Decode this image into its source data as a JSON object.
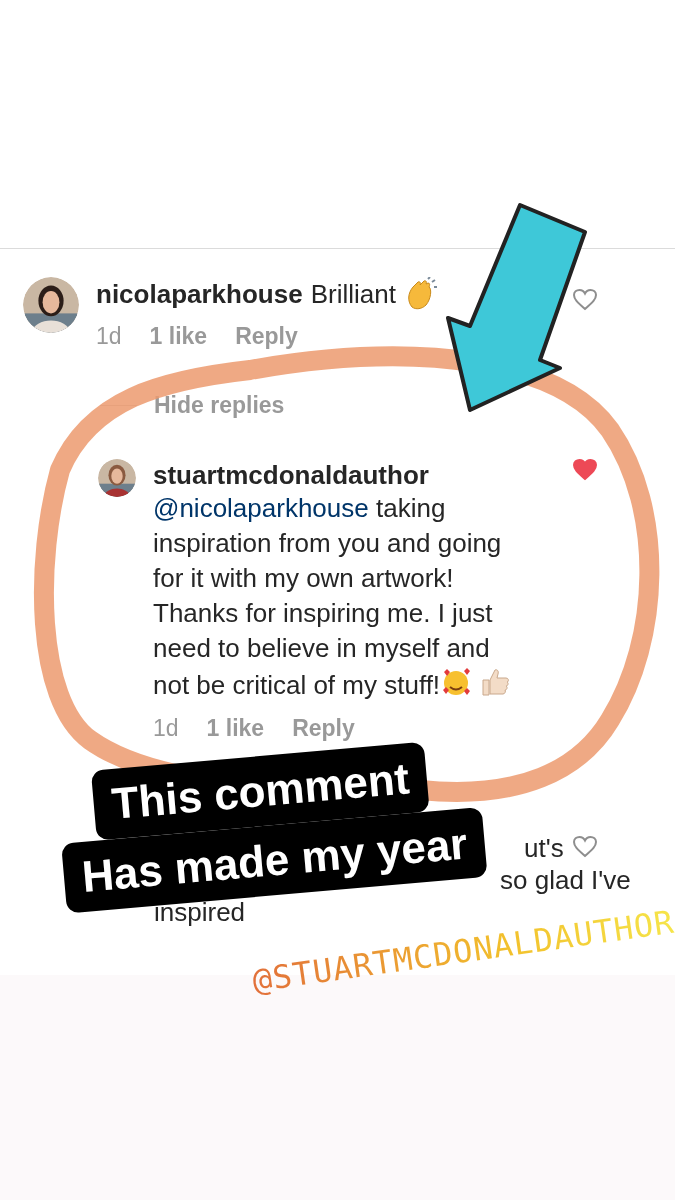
{
  "comments": [
    {
      "username": "nicolaparkhouse",
      "text": "Brilliant",
      "time": "1d",
      "likes": "1 like",
      "reply_label": "Reply",
      "liked": false,
      "replies_toggle": "Hide replies",
      "replies": [
        {
          "username": "stuartmcdonaldauthor",
          "mention": "@nicolaparkhouse",
          "text": "taking\ninspiration from you and going\nfor it with my own artwork!\nThanks for inspiring me. I just\nneed to believe in myself and\nnot be critical of my stuff!",
          "time": "1d",
          "likes": "1 like",
          "reply_label": "Reply",
          "liked": true
        }
      ]
    }
  ],
  "partial_comment": {
    "lines": [
      "ut's",
      "so glad I've",
      "inspired"
    ],
    "liked": false
  },
  "stickers": [
    {
      "kind": "label",
      "lines": [
        "This comment",
        "Has made my year"
      ]
    },
    {
      "kind": "mention",
      "text": "@STUARTMCDONALDAUTHOR"
    }
  ]
}
